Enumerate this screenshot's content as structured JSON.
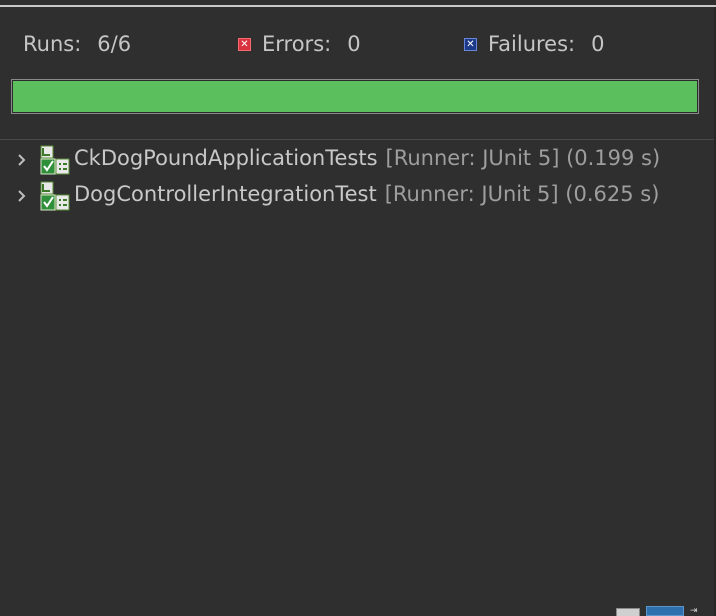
{
  "counters": {
    "runs_label": "Runs:",
    "runs_value": "6/6",
    "errors_label": "Errors:",
    "errors_value": "0",
    "failures_label": "Failures:",
    "failures_value": "0"
  },
  "progress": {
    "fraction": 1.0,
    "color": "#5cbf5e"
  },
  "tests": [
    {
      "name": "CkDogPoundApplicationTests",
      "meta": "[Runner: JUnit 5] (0.199 s)",
      "icon": "test-suite-passed-icon",
      "expanded": false
    },
    {
      "name": "DogControllerIntegrationTest",
      "meta": "[Runner: JUnit 5] (0.625 s)",
      "icon": "test-suite-passed-icon",
      "expanded": false
    }
  ],
  "colors": {
    "background": "#2f2f2f",
    "error": "#d9333f",
    "failure": "#1d3a8a",
    "success": "#5cbf5e"
  }
}
